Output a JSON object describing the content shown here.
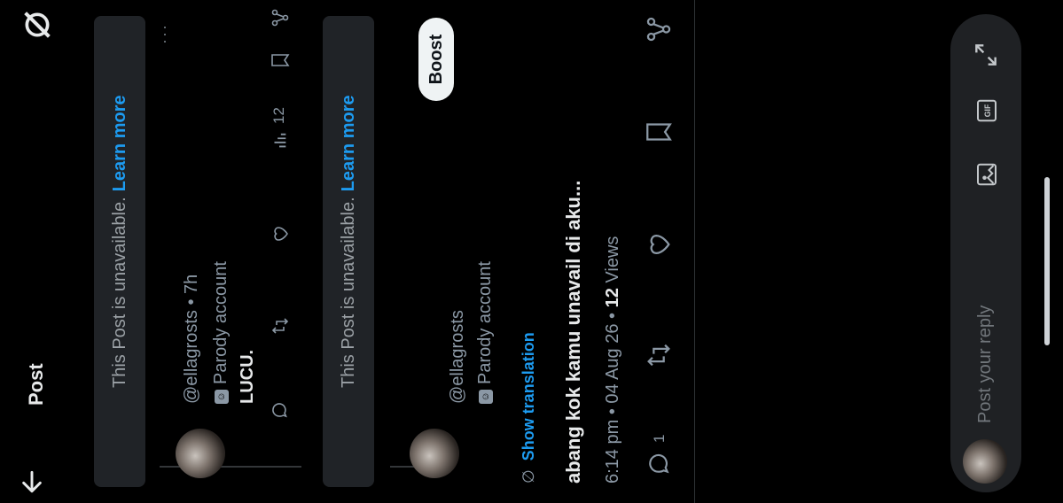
{
  "header": {
    "title": "Post"
  },
  "unavailable": {
    "message": "This Post is unavailable.",
    "link": "Learn more"
  },
  "reply1": {
    "handle": "@ellagrosts",
    "time": "7h",
    "parody": "Parody account",
    "text": "LUCU.",
    "views": "12"
  },
  "main": {
    "handle": "@ellagrosts",
    "parody": "Parody account",
    "boost_label": "Boost",
    "show_translation": "Show translation",
    "text": "abang kok kamu unavail di aku...",
    "time": "6:14 pm",
    "date": "04 Aug 26",
    "views_count": "12",
    "views_label": "Views",
    "reply_count": "1"
  },
  "composer": {
    "placeholder": "Post your reply"
  },
  "icons": {
    "back": "arrow-left-icon",
    "grok": "grok-icon",
    "more": "more-icon",
    "reply": "reply-icon",
    "repost": "repost-icon",
    "like": "heart-icon",
    "views": "views-icon",
    "bookmark": "bookmark-icon",
    "share": "share-icon",
    "image": "image-icon",
    "gif": "gif-icon",
    "expand": "expand-icon"
  },
  "colors": {
    "accent": "#1d9bf0",
    "background": "#000000"
  }
}
